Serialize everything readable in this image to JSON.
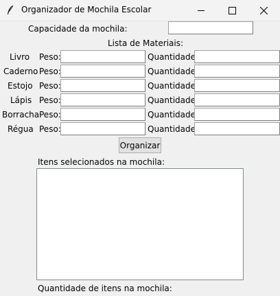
{
  "window": {
    "title": "Organizador de Mochila Escolar"
  },
  "capacity": {
    "label": "Capacidade da mochila:",
    "value": ""
  },
  "materials_header": "Lista de Materiais:",
  "materials": [
    {
      "name": "Livro",
      "weight_label": "Peso:",
      "weight": "",
      "qty_label": "Quantidade:",
      "qty": ""
    },
    {
      "name": "Caderno",
      "weight_label": "Peso:",
      "weight": "",
      "qty_label": "Quantidade:",
      "qty": ""
    },
    {
      "name": "Estojo",
      "weight_label": "Peso:",
      "weight": "",
      "qty_label": "Quantidade:",
      "qty": ""
    },
    {
      "name": "Lápis",
      "weight_label": "Peso:",
      "weight": "",
      "qty_label": "Quantidade:",
      "qty": ""
    },
    {
      "name": "Borracha",
      "weight_label": "Peso:",
      "weight": "",
      "qty_label": "Quantidade:",
      "qty": ""
    },
    {
      "name": "Régua",
      "weight_label": "Peso:",
      "weight": "",
      "qty_label": "Quantidade:",
      "qty": ""
    }
  ],
  "organize_button": "Organizar",
  "selected_label": "Itens selecionados na mochila:",
  "selected_items": [],
  "count_label": "Quantidade de itens na mochila:"
}
